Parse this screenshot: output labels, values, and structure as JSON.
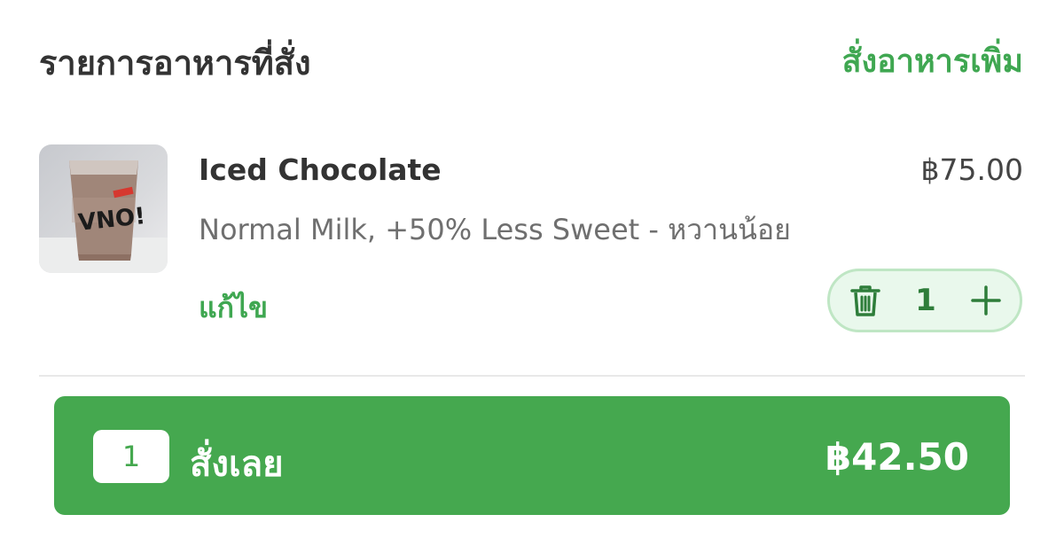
{
  "header": {
    "title": "รายการอาหารที่สั่ง",
    "add_more_label": "สั่งอาหารเพิ่ม"
  },
  "cart_item": {
    "name": "Iced Chocolate",
    "price": "฿75.00",
    "options": "Normal Milk, +50% Less Sweet - หวานน้อย",
    "edit_label": "แก้ไข",
    "quantity": "1",
    "image_icon": "iced-chocolate-cup"
  },
  "order_bar": {
    "count": "1",
    "label": "สั่งเลย",
    "total": "฿42.50"
  },
  "colors": {
    "accent": "#3fa751",
    "bar": "#45a84f",
    "stepper_bg": "#e9f8ec"
  }
}
